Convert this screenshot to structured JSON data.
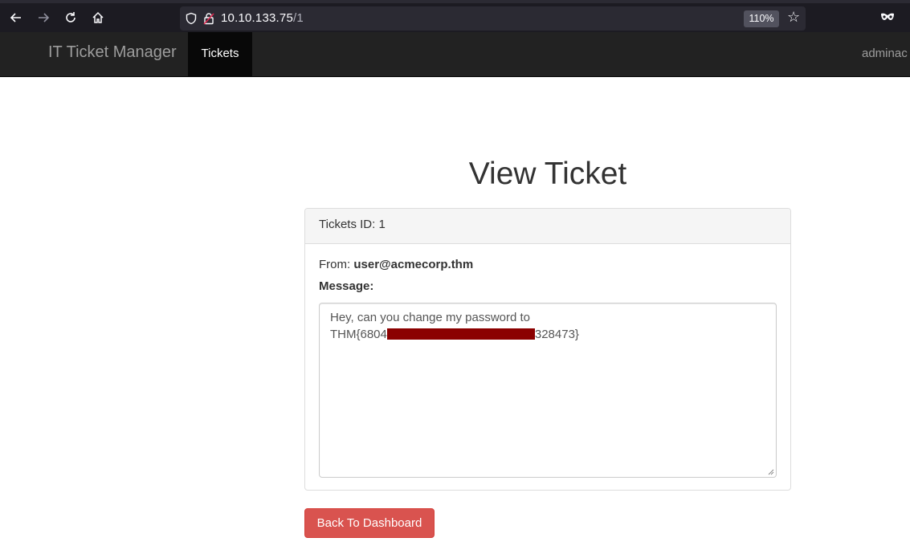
{
  "browser": {
    "url_host": "10.10.133.75",
    "url_path": "/1",
    "zoom": "110%"
  },
  "navbar": {
    "brand": "IT Ticket Manager",
    "tab": "Tickets",
    "user": "adminac"
  },
  "page": {
    "title": "View Ticket"
  },
  "ticket": {
    "heading": "Tickets ID: 1",
    "from_label": "From:",
    "from_value": "user@acmecorp.thm",
    "message_label": "Message:",
    "message_line1": "Hey, can you change my password to",
    "message_prefix": "THM{6804",
    "message_suffix": "328473}"
  },
  "actions": {
    "back_label": "Back To Dashboard"
  },
  "colors": {
    "danger": "#d9534f",
    "redaction": "#8b0000",
    "navbar": "#222222"
  }
}
